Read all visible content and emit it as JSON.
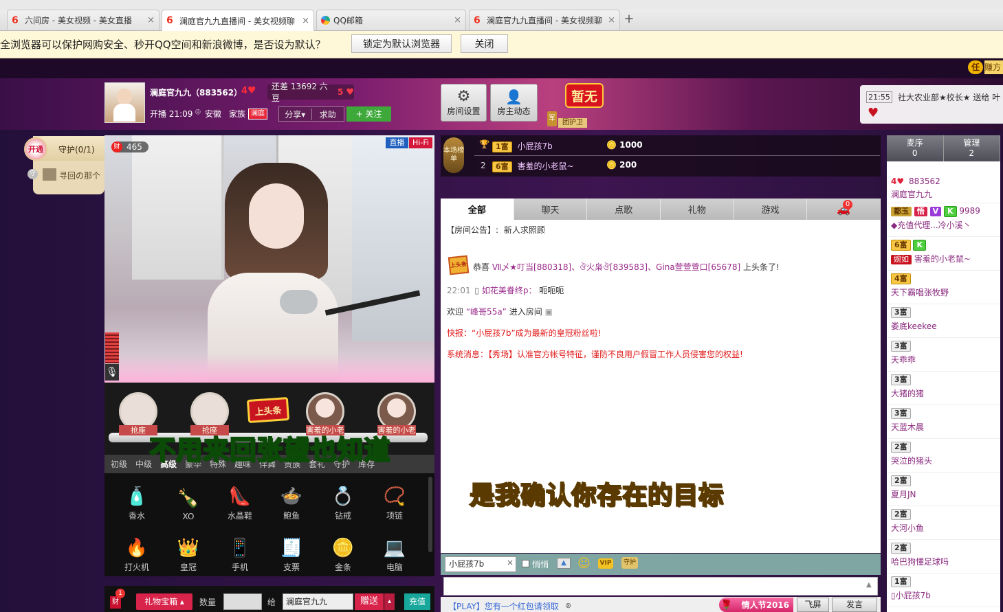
{
  "browser": {
    "tabs": [
      {
        "label": "六间房 - 美女视频 - 美女直播",
        "icon": "six-rooms-icon",
        "active": false
      },
      {
        "label": "澜庭官九九直播间 - 美女视频聊",
        "icon": "six-rooms-icon",
        "active": true
      },
      {
        "label": "QQ邮箱",
        "icon": "qq-browser-icon",
        "active": false
      },
      {
        "label": "澜庭官九九直播间 - 美女视频聊",
        "icon": "six-rooms-icon",
        "active": false
      }
    ],
    "close_glyph": "×",
    "new_tab_glyph": "+",
    "notice": {
      "text": "全浏览器可以保护网购安全、秒开QQ空间和新浪微博，是否设为默认？",
      "set_default_label": "锁定为默认浏览器",
      "close_label": "关闭"
    }
  },
  "header": {
    "anchor_name": "澜庭官九九（883562）",
    "anchor_level": "4",
    "gap_text": "还差 13692 六豆",
    "next_level": "5",
    "start_time_label": "开播 21:09",
    "location": "安徽",
    "family_label": "家族",
    "family_badge": "澜庭",
    "share_label": "分享",
    "share_caret": "▾",
    "help_label": "求助",
    "follow_label": "+ 关注",
    "room_settings_label": "房间设置",
    "host_news_label": "房主动态",
    "temp_none": "暂无",
    "guard_team_label": "团护卫",
    "guard_team_badge": "军",
    "feed_time": "21:55",
    "feed_text": "社大农业部★校长★ 送给 叶",
    "top_right_badge": "任",
    "top_right_text": "赚方"
  },
  "guard": {
    "open_label": "开通",
    "title": "守护(0/1)",
    "item_icon_text": "守",
    "item_label": "寻回の那个"
  },
  "video": {
    "viewer_badge": "财",
    "viewer_count": "465",
    "live_label": "直播",
    "hifi_label": "Hi-Fi",
    "subtitle_yellow": "是我确认你存在的目标",
    "subtitle_green": "不用来回张望也知道"
  },
  "seats": [
    {
      "label": "抢座"
    },
    {
      "label": "抢座"
    },
    {
      "label": "上头条"
    },
    {
      "label": "害羞的小老"
    },
    {
      "label": "害羞的小老"
    }
  ],
  "gift_tabs": [
    "初级",
    "中级",
    "高级",
    "豪华",
    "特殊",
    "趣味",
    "伴舞",
    "贵族",
    "套礼",
    "守护",
    "库存"
  ],
  "gift_tab_active": 2,
  "gifts": [
    {
      "name": "香水",
      "icon": "perfume-icon",
      "glyph": "🧴"
    },
    {
      "name": "XO",
      "icon": "xo-bottle-icon",
      "glyph": "🍾"
    },
    {
      "name": "水晶鞋",
      "icon": "crystal-shoe-icon",
      "glyph": "👠"
    },
    {
      "name": "鲍鱼",
      "icon": "abalone-icon",
      "glyph": "🍲"
    },
    {
      "name": "钻戒",
      "icon": "diamond-ring-icon",
      "glyph": "💍"
    },
    {
      "name": "项链",
      "icon": "necklace-icon",
      "glyph": "📿"
    },
    {
      "name": "打火机",
      "icon": "lighter-icon",
      "glyph": "🔥"
    },
    {
      "name": "皇冠",
      "icon": "crown-icon",
      "glyph": "👑"
    },
    {
      "name": "手机",
      "icon": "phone-icon",
      "glyph": "📱"
    },
    {
      "name": "支票",
      "icon": "check-icon",
      "glyph": "🧾"
    },
    {
      "name": "金条",
      "icon": "gold-bar-icon",
      "glyph": "🪙"
    },
    {
      "name": "电脑",
      "icon": "laptop-icon",
      "glyph": "💻"
    }
  ],
  "gift_bar": {
    "wealth_badge": "财",
    "wealth_count": "1",
    "gift_box_label": "礼物宝箱 ▴",
    "quantity_label": "数量",
    "to_label": "给",
    "recipient": "澜庭官九九",
    "send_label": "赠送",
    "recharge_label": "充值"
  },
  "rank": {
    "title": "本场榜单",
    "rows": [
      {
        "rank": "1",
        "level": "1富",
        "name": "小屁孩7b",
        "amount": "1000"
      },
      {
        "rank": "2",
        "level": "6富",
        "name": "害羞的小老鼠~",
        "amount": "200"
      }
    ]
  },
  "chat_tabs": [
    "全部",
    "聊天",
    "点歌",
    "礼物",
    "游戏"
  ],
  "chat_car_count": "0",
  "chat": {
    "announcement_label": "【房间公告】:",
    "announcement_text": "新人求照顾",
    "headline_badge": "上头条",
    "headline_prefix": "恭喜",
    "headline_names": "Ⅶ乄★叮当[880318]、ঔ火枭ঔ[839583]、Gina萱萱萱口[65678]",
    "headline_suffix": "上头条了!",
    "msg_time": "22:01",
    "msg_user": "如花美眷终p：",
    "msg_text": "呃呃呃",
    "welcome_prefix": "欢迎",
    "welcome_user": "“峰哥55a”",
    "welcome_suffix": "进入房间",
    "news": "快报：“小屁孩7b”成为最新的皇冠粉丝啦!",
    "system": "系统消息：【秀场】认准官方帐号特征，谨防不良用户假冒工作人员侵害您的权益!"
  },
  "chat_input": {
    "target": "小屁孩7b",
    "whisper_label": "悄悄",
    "vip_label": "VIP",
    "guard_label": "守护",
    "fly_label": "飞屏",
    "speak_label": "发言",
    "valentine_label": "情人节2016",
    "play_notice": "【PLAY】您有一个红包请领取"
  },
  "user_panel": {
    "mic_label": "麦序",
    "mic_count": "0",
    "admin_label": "管理",
    "admin_count": "2",
    "users": [
      {
        "badges": [
          "4"
        ],
        "extra": "883562",
        "name": "澜庭官九九"
      },
      {
        "badges": [
          "都玉",
          "悟",
          "V",
          "K"
        ],
        "extra": "9989",
        "name": "◆充值代理...冷小溪丶"
      },
      {
        "badges": [
          "6富",
          "K"
        ],
        "extra": "婉如",
        "name": "害羞的小老鼠~"
      },
      {
        "badges": [
          "4富"
        ],
        "extra": "",
        "name": "天下霸唱张牧野"
      },
      {
        "badges": [
          "3富"
        ],
        "extra": "",
        "name": "娄底keekee"
      },
      {
        "badges": [
          "3富"
        ],
        "extra": "",
        "name": "天乖乖"
      },
      {
        "badges": [
          "3富"
        ],
        "extra": "",
        "name": "大猪的猪"
      },
      {
        "badges": [
          "3富"
        ],
        "extra": "",
        "name": "天蓝木晨"
      },
      {
        "badges": [
          "2富"
        ],
        "extra": "",
        "name": "哭泣的猪头"
      },
      {
        "badges": [
          "2富"
        ],
        "extra": "",
        "name": "夏月JN"
      },
      {
        "badges": [
          "2富"
        ],
        "extra": "",
        "name": "大河小鱼"
      },
      {
        "badges": [
          "2富"
        ],
        "extra": "",
        "name": "哈巴狗懂足球吗"
      },
      {
        "badges": [
          "1富"
        ],
        "extra": "",
        "name": "小屁孩7b"
      }
    ]
  },
  "colors": {
    "accent_red": "#e0203a",
    "follow_green": "#3ea83a",
    "chat_tabbar": "#bdbdbd",
    "purple_bg": "#3d1550"
  }
}
